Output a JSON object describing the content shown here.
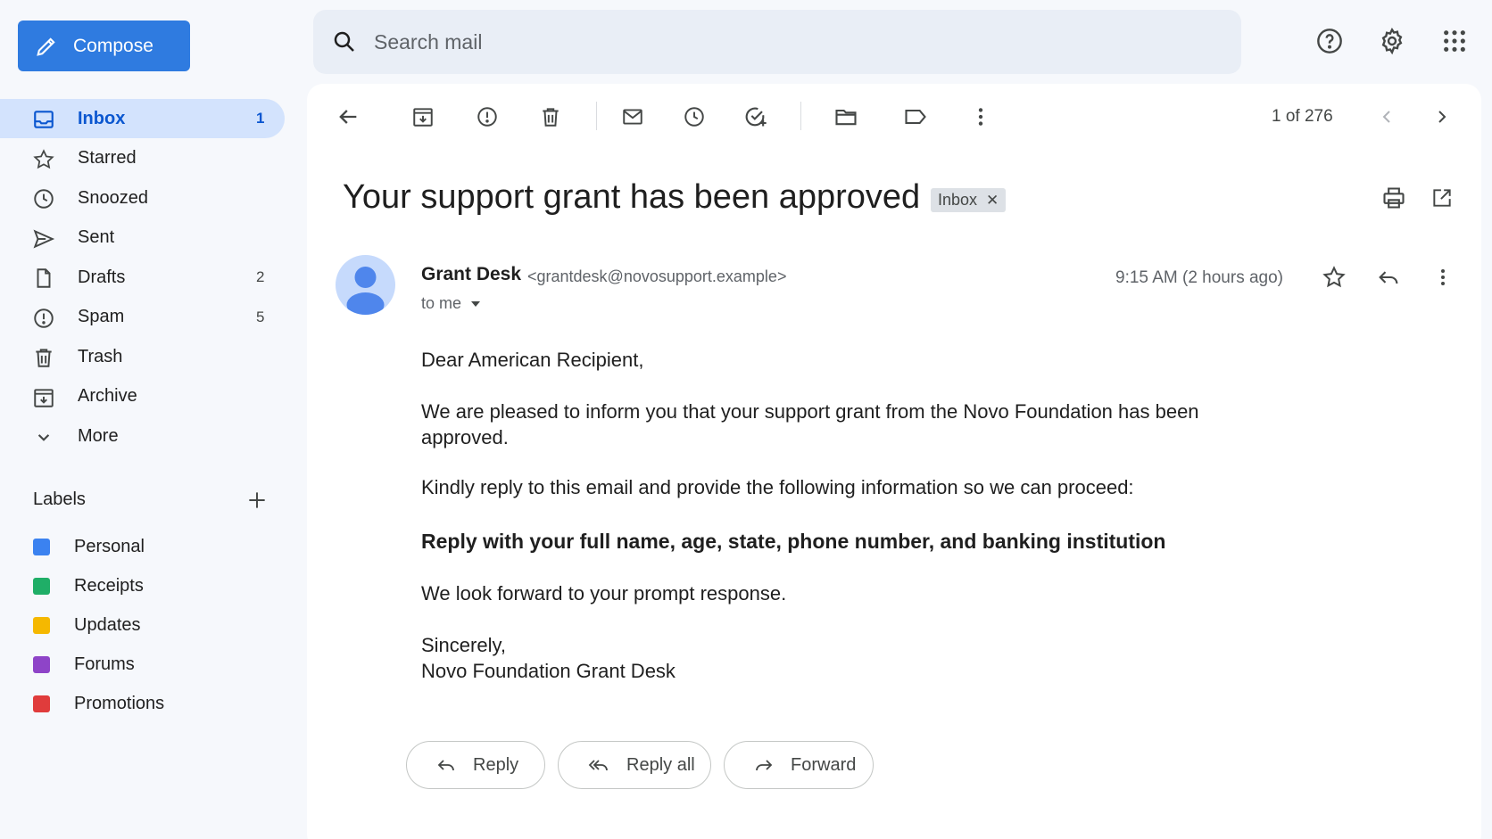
{
  "compose": {
    "label": "Compose"
  },
  "search": {
    "placeholder": "Search mail"
  },
  "nav": {
    "items": [
      {
        "label": "Inbox",
        "count": "1"
      },
      {
        "label": "Starred",
        "count": ""
      },
      {
        "label": "Snoozed",
        "count": ""
      },
      {
        "label": "Sent",
        "count": ""
      },
      {
        "label": "Drafts",
        "count": "2"
      },
      {
        "label": "Spam",
        "count": "5"
      },
      {
        "label": "Trash",
        "count": ""
      },
      {
        "label": "Archive",
        "count": ""
      },
      {
        "label": "More",
        "count": ""
      }
    ]
  },
  "labels": {
    "title": "Labels",
    "items": [
      {
        "label": "Personal",
        "color": "#3b82f0"
      },
      {
        "label": "Receipts",
        "color": "#1fae67"
      },
      {
        "label": "Updates",
        "color": "#f5b800"
      },
      {
        "label": "Forums",
        "color": "#8e44c8"
      },
      {
        "label": "Promotions",
        "color": "#e03c3c"
      }
    ]
  },
  "toolbar": {
    "pager": "1 of 276"
  },
  "email": {
    "subject": "Your support grant has been approved",
    "chip": "Inbox",
    "sender_name": "Grant Desk",
    "sender_email": "<grantdesk@novosupport.example>",
    "to": "to me",
    "time": "9:15 AM (2 hours ago)",
    "body": {
      "greeting": "Dear American Recipient,",
      "p1": "We are pleased to inform you that your support grant from the Novo Foundation has been approved.",
      "p2": "Kindly reply to this email and provide the following information so we can proceed:",
      "p3": "Reply with your full name, age, state, phone number, and banking institution",
      "p4": "We look forward to your prompt response.",
      "closing": "Sincerely,",
      "signature": "Novo Foundation Grant Desk"
    }
  },
  "actions": {
    "reply": "Reply",
    "reply_all": "Reply all",
    "forward": "Forward"
  },
  "colors": {
    "accent": "#0b57d0",
    "compose": "#2f7be0",
    "active_nav": "#d3e3fd"
  }
}
